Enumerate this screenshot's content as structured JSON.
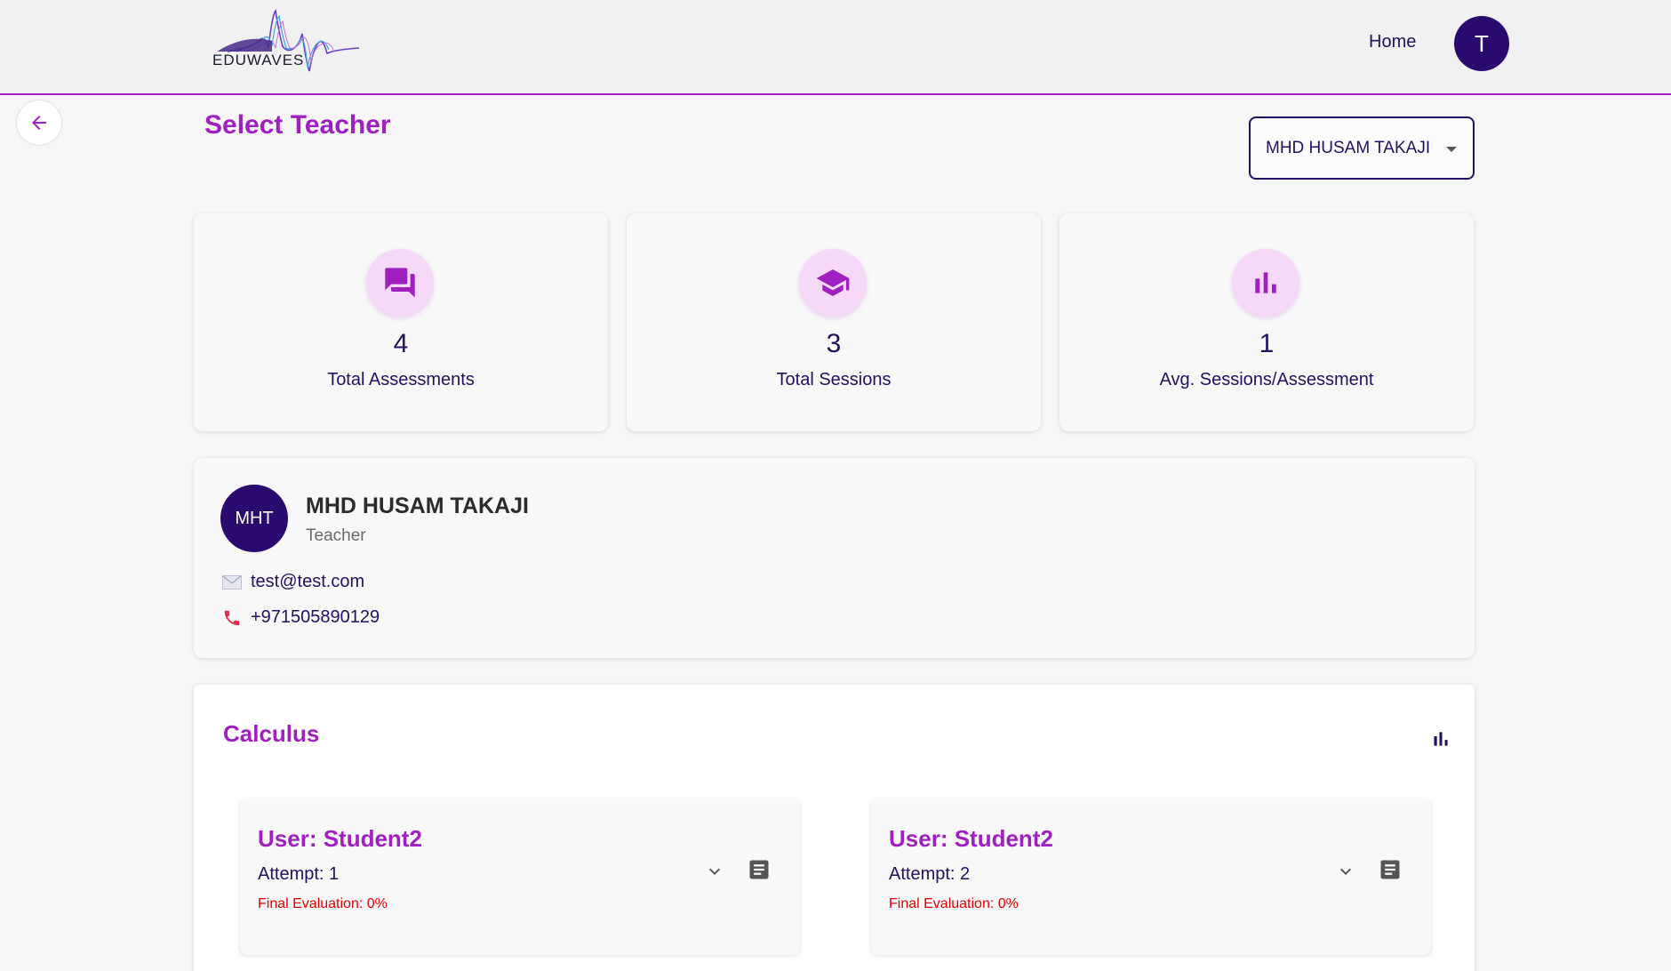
{
  "header": {
    "logo_text": "EDUWAVES",
    "nav_home": "Home",
    "user_initial": "T"
  },
  "page": {
    "title": "Select Teacher",
    "teacher_select_value": "MHD HUSAM TAKAJI"
  },
  "stats": [
    {
      "icon": "forum-icon",
      "value": "4",
      "label": "Total Assessments"
    },
    {
      "icon": "school-icon",
      "value": "3",
      "label": "Total Sessions"
    },
    {
      "icon": "bar-chart-icon",
      "value": "1",
      "label": "Avg. Sessions/Assessment"
    }
  ],
  "profile": {
    "initials": "MHT",
    "name": "MHD HUSAM TAKAJI",
    "role": "Teacher",
    "email": "test@test.com",
    "phone": "+971505890129"
  },
  "course": {
    "title": "Calculus",
    "attempts": [
      {
        "user": "User: Student2",
        "attempt": "Attempt: 1",
        "evaluation": "Final Evaluation: 0%"
      },
      {
        "user": "User: Student2",
        "attempt": "Attempt: 2",
        "evaluation": "Final Evaluation: 0%"
      }
    ]
  },
  "colors": {
    "accent": "#a01fc0",
    "primary": "#24105f",
    "avatar": "#2a0a6e",
    "icon_bg": "#f6d8f8",
    "error": "#e00000"
  }
}
